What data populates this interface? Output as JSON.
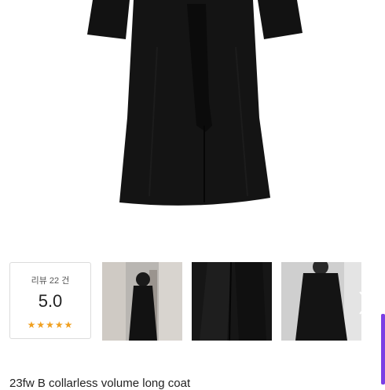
{
  "review_summary": {
    "count_label": "리뷰 22 건",
    "score": "5.0",
    "rating_stars": 5,
    "stars_text": "★★★★★",
    "star_color": "#f0a020"
  },
  "gallery": {
    "thumbnails": [
      {
        "kind": "mirror-selfie-long-coat"
      },
      {
        "kind": "coat-detail-closeup"
      },
      {
        "kind": "coat-front-view"
      }
    ],
    "next_icon": "chevron-right-icon"
  },
  "product": {
    "title": "23fw B collarless volume long coat"
  },
  "colors": {
    "coat": "#111111",
    "accent": "#7b3fe4"
  }
}
